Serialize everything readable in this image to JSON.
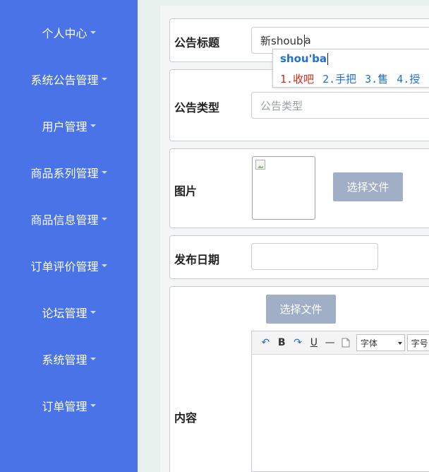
{
  "sidebar": {
    "items": [
      {
        "label": "个人中心"
      },
      {
        "label": "系统公告管理"
      },
      {
        "label": "用户管理"
      },
      {
        "label": "商品系列管理"
      },
      {
        "label": "商品信息管理"
      },
      {
        "label": "订单评价管理"
      },
      {
        "label": "论坛管理"
      },
      {
        "label": "系统管理"
      },
      {
        "label": "订单管理"
      }
    ]
  },
  "form": {
    "title_label": "公告标题",
    "title_value": "新shoub",
    "title_value_tail": "a",
    "type_label": "公告类型",
    "type_placeholder": "公告类型",
    "image_label": "图片",
    "image_button": "选择文件",
    "date_label": "发布日期",
    "date_value": "",
    "content_label": "内容",
    "content_button": "选择文件"
  },
  "ime": {
    "pinyin": "shou'ba",
    "candidates": [
      "1.收吧",
      "2.手把",
      "3.售",
      "4.授"
    ]
  },
  "editor": {
    "toolbar": {
      "undo": "↶",
      "bold": "B",
      "redo": "↷",
      "underline": "U",
      "hr": "—",
      "font_select": "字体",
      "size_select": "字号"
    }
  },
  "colors": {
    "sidebar_bg": "#4a73e8",
    "button_bg": "#a0aec6",
    "ime_pinyin": "#1e6fd6",
    "ime_first": "#d0281c"
  }
}
